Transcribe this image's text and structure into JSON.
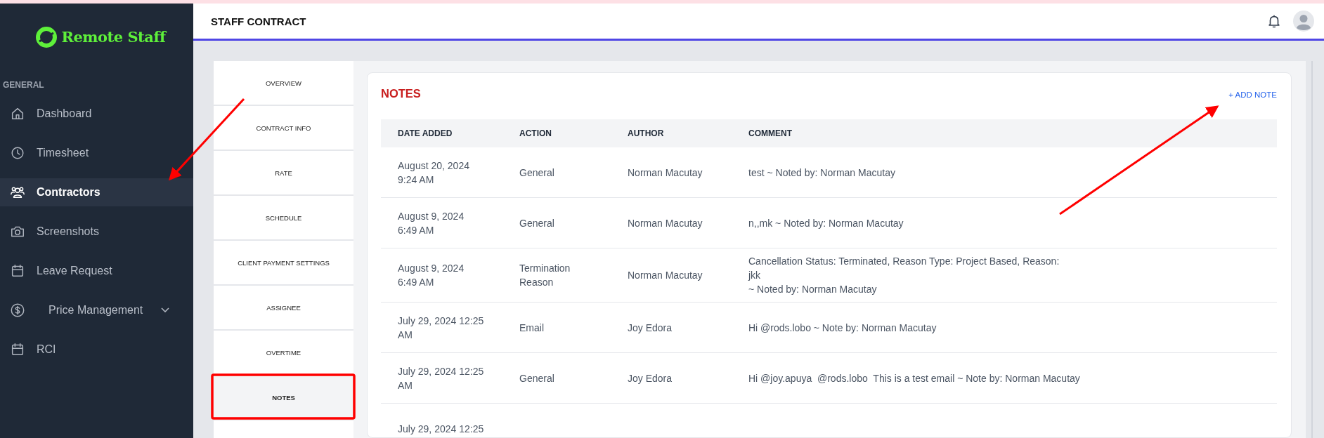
{
  "sidebar": {
    "logo": "Remote Staff",
    "section": "GENERAL",
    "items": [
      {
        "label": "Dashboard",
        "kind": "home",
        "selected": false
      },
      {
        "label": "Timesheet",
        "kind": "clock",
        "selected": false
      },
      {
        "label": "Contractors",
        "kind": "users",
        "selected": true
      },
      {
        "label": "Screenshots",
        "kind": "camera",
        "selected": false
      },
      {
        "label": "Leave Request",
        "kind": "calendar",
        "selected": false
      },
      {
        "label": "Price Management",
        "kind": "dollar",
        "selected": false,
        "expandable": true
      },
      {
        "label": "RCI",
        "kind": "calendar",
        "selected": false
      }
    ]
  },
  "header": {
    "title": "STAFF CONTRACT"
  },
  "tabs": [
    {
      "label": "OVERVIEW",
      "selected": false
    },
    {
      "label": "CONTRACT INFO",
      "selected": false
    },
    {
      "label": "RATE",
      "selected": false
    },
    {
      "label": "SCHEDULE",
      "selected": false
    },
    {
      "label": "CLIENT PAYMENT SETTINGS",
      "selected": false
    },
    {
      "label": "ASSIGNEE",
      "selected": false
    },
    {
      "label": "OVERTIME",
      "selected": false
    },
    {
      "label": "NOTES",
      "selected": true
    }
  ],
  "notes": {
    "title": "NOTES",
    "add_button": "+ ADD NOTE",
    "columns": [
      "DATE ADDED",
      "ACTION",
      "AUTHOR",
      "COMMENT"
    ],
    "rows": [
      {
        "date": "August 20, 2024\n9:24 AM",
        "action": "General",
        "author": "Norman Macutay",
        "comment": "test ~ Noted by: Norman Macutay"
      },
      {
        "date": "August 9, 2024\n6:49 AM",
        "action": "General",
        "author": "Norman Macutay",
        "comment": "n,,mk ~ Noted by: Norman Macutay"
      },
      {
        "date": "August 9, 2024\n6:49 AM",
        "action": "Termination Reason",
        "author": "Norman Macutay",
        "comment": "Cancellation Status: Terminated, Reason Type: Project Based, Reason:\njkk\n~ Noted by: Norman Macutay"
      },
      {
        "date": "July 29, 2024 12:25 AM",
        "action": "Email",
        "author": "Joy Edora",
        "comment": "Hi @rods.lobo ~ Note by: Norman Macutay"
      },
      {
        "date": "July 29, 2024 12:25 AM",
        "action": "General",
        "author": "Joy Edora",
        "comment": "Hi @joy.apuya  @rods.lobo  This is a test email ~ Note by: Norman Macutay"
      },
      {
        "date": "July 29, 2024 12:25"
      }
    ]
  }
}
